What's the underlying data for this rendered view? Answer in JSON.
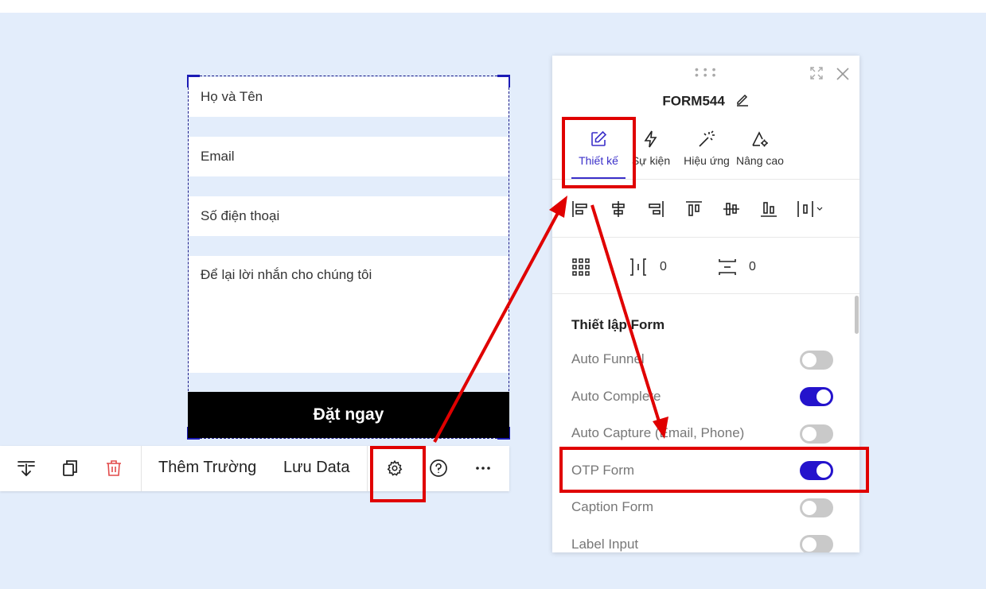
{
  "form": {
    "fields": [
      {
        "placeholder": "Họ và Tên"
      },
      {
        "placeholder": "Email"
      },
      {
        "placeholder": "Số điện thoại"
      },
      {
        "placeholder": "Để lại lời nhắn cho chúng tôi"
      }
    ],
    "submit_label": "Đặt ngay"
  },
  "toolbar": {
    "icons": [
      "sort-down-icon",
      "copy-icon",
      "trash-icon",
      "gear-icon",
      "help-icon",
      "more-icon"
    ],
    "add_field_label": "Thêm Trường",
    "save_data_label": "Lưu Data"
  },
  "panel": {
    "title": "FORM544",
    "tabs": [
      {
        "label": "Thiết kế",
        "icon": "edit-icon",
        "active": true
      },
      {
        "label": "Sự kiện",
        "icon": "lightning-icon",
        "active": false
      },
      {
        "label": "Hiệu ứng",
        "icon": "magic-wand-icon",
        "active": false
      },
      {
        "label": "Nâng cao",
        "icon": "advanced-settings-icon",
        "active": false
      }
    ],
    "spacing": {
      "horizontal_value": "0",
      "vertical_value": "0"
    },
    "section_title": "Thiết lập Form",
    "options": [
      {
        "label": "Auto Funnel",
        "on": false
      },
      {
        "label": "Auto Complete",
        "on": true
      },
      {
        "label": "Auto Capture (Email, Phone)",
        "on": false
      },
      {
        "label": "OTP Form",
        "on": true
      },
      {
        "label": "Caption Form",
        "on": false
      },
      {
        "label": "Label Input",
        "on": false
      }
    ]
  },
  "colors": {
    "accent": "#2413cc",
    "highlight": "#e00000",
    "canvas": "#e3edfb"
  }
}
